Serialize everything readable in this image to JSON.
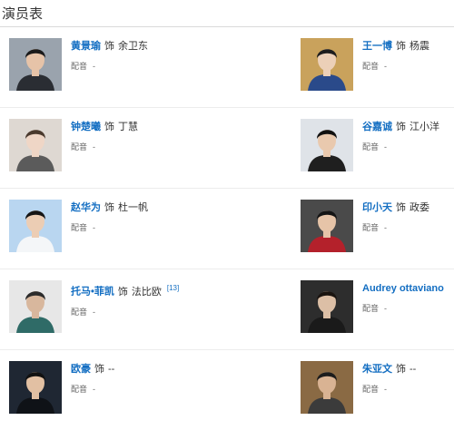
{
  "section": {
    "title": "演员表"
  },
  "cast": [
    {
      "left": {
        "actor": "黄景瑜",
        "as": "饰",
        "role": "余卫东",
        "va_label": "配音",
        "va": "-",
        "photo": {
          "bg": "#9aa3ad",
          "skin": "#e6c3a8",
          "hair": "#1a1a1a",
          "cloth": "#2a2d33"
        }
      },
      "right": {
        "actor": "王一博",
        "as": "饰",
        "role": "杨震",
        "va_label": "配音",
        "va": "-",
        "photo": {
          "bg": "#c9a25c",
          "skin": "#ecd0b8",
          "hair": "#1d1d1d",
          "cloth": "#2a4a8a"
        }
      }
    },
    {
      "left": {
        "actor": "钟楚曦",
        "as": "饰",
        "role": "丁慧",
        "va_label": "配音",
        "va": "-",
        "photo": {
          "bg": "#ded8d2",
          "skin": "#efd6c6",
          "hair": "#4a3a2e",
          "cloth": "#5b5b5b"
        }
      },
      "right": {
        "actor": "谷嘉诚",
        "as": "饰",
        "role": "江小洋",
        "va_label": "配音",
        "va": "-",
        "photo": {
          "bg": "#dfe3e8",
          "skin": "#e9c9ae",
          "hair": "#111111",
          "cloth": "#1f1f1f"
        }
      }
    },
    {
      "left": {
        "actor": "赵华为",
        "as": "饰",
        "role": "杜一帆",
        "va_label": "配音",
        "va": "-",
        "photo": {
          "bg": "#b9d6f0",
          "skin": "#eccdb4",
          "hair": "#151515",
          "cloth": "#f4f6f8"
        }
      },
      "right": {
        "actor": "印小天",
        "as": "饰",
        "role": "政委",
        "va_label": "配音",
        "va": "-",
        "photo": {
          "bg": "#4a4a4a",
          "skin": "#e6c4a8",
          "hair": "#141414",
          "cloth": "#b4212b"
        }
      }
    },
    {
      "left": {
        "actor": "托马•菲凯",
        "as": "饰",
        "role": "法比欧",
        "sup": "[13]",
        "va_label": "配音",
        "va": "-",
        "photo": {
          "bg": "#e7e7e7",
          "skin": "#d8b79d",
          "hair": "#2b2b2b",
          "cloth": "#2f6b67"
        }
      },
      "right": {
        "actor": "Audrey ottaviano",
        "as": "",
        "role": "",
        "va_label": "配音",
        "va": "-",
        "photo": {
          "bg": "#2d2d2d",
          "skin": "#dcbfa6",
          "hair": "#1a1410",
          "cloth": "#1a1a1a"
        }
      }
    },
    {
      "left": {
        "actor": "欧豪",
        "as": "饰",
        "role": "--",
        "va_label": "配音",
        "va": "-",
        "photo": {
          "bg": "#1f2733",
          "skin": "#e2c0a3",
          "hair": "#111111",
          "cloth": "#0f1217"
        }
      },
      "right": {
        "actor": "朱亚文",
        "as": "饰",
        "role": "--",
        "va_label": "配音",
        "va": "-",
        "photo": {
          "bg": "#8a6a44",
          "skin": "#d9b393",
          "hair": "#1c1c1c",
          "cloth": "#3b3b3b"
        }
      }
    }
  ]
}
